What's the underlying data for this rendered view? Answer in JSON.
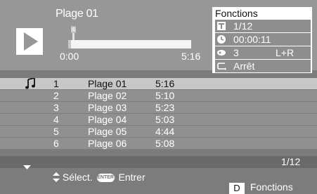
{
  "now_playing": {
    "title": "Plage 01",
    "time_current": "0:00",
    "time_total": "5:16",
    "progress_fraction": 0.02
  },
  "functions": {
    "title": "Fonctions",
    "track": "1/12",
    "elapsed": "00:00:11",
    "audio_channel": "3",
    "audio_mode": "L+R",
    "repeat": "Arrêt"
  },
  "tracks": [
    {
      "num": "1",
      "name": "Plage 01",
      "duration": "5:16",
      "current": true
    },
    {
      "num": "2",
      "name": "Plage 02",
      "duration": "5:10",
      "current": false
    },
    {
      "num": "3",
      "name": "Plage 03",
      "duration": "5:23",
      "current": false
    },
    {
      "num": "4",
      "name": "Plage 04",
      "duration": "5:03",
      "current": false
    },
    {
      "num": "5",
      "name": "Plage 05",
      "duration": "4:44",
      "current": false
    },
    {
      "num": "6",
      "name": "Plage 06",
      "duration": "5:08",
      "current": false
    }
  ],
  "page_indicator": "1/12",
  "hints": {
    "select": "Sélect.",
    "enter_badge": "ENTER",
    "enter": "Entrer",
    "functions_key": "D",
    "functions": "Fonctions"
  },
  "colors": {
    "background": "#7c7c7c",
    "top_panel": "#979797",
    "row": "#909090",
    "row_current": "#c7c7c7"
  }
}
